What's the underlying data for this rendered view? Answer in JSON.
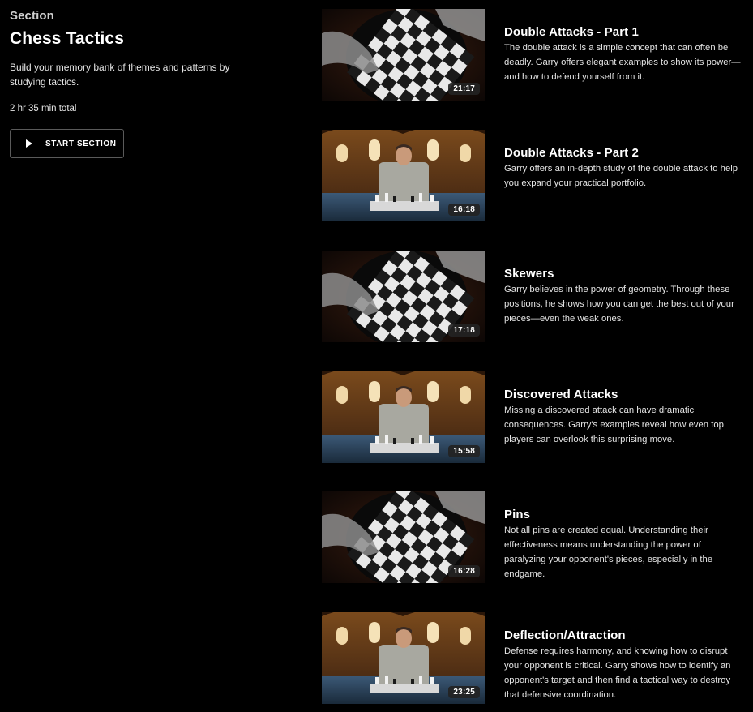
{
  "section": {
    "eyebrow": "Section",
    "title": "Chess Tactics",
    "description": "Build your memory bank of themes and patterns by studying tactics.",
    "total": "2 hr 35 min total",
    "start_label": "START SECTION"
  },
  "lessons": [
    {
      "title": "Double Attacks - Part 1",
      "description": "The double attack is a simple concept that can often be deadly. Garry offers elegant examples to show its power—and how to defend yourself from it.",
      "duration": "21:17",
      "thumbnail": "board-closeup"
    },
    {
      "title": "Double Attacks - Part 2",
      "description": "Garry offers an in-depth study of the double attack to help you expand your practical portfolio.",
      "duration": "16:18",
      "thumbnail": "instructor-hall"
    },
    {
      "title": "Skewers",
      "description": "Garry believes in the power of geometry. Through these positions, he shows how you can get the best out of your pieces—even the weak ones.",
      "duration": "17:18",
      "thumbnail": "board-closeup"
    },
    {
      "title": "Discovered Attacks",
      "description": "Missing a discovered attack can have dramatic consequences. Garry's examples reveal how even top players can overlook this surprising move.",
      "duration": "15:58",
      "thumbnail": "instructor-hall"
    },
    {
      "title": "Pins",
      "description": "Not all pins are created equal. Understanding their effectiveness means understanding the power of paralyzing your opponent's pieces, especially in the endgame.",
      "duration": "16:28",
      "thumbnail": "board-closeup"
    },
    {
      "title": "Deflection/Attraction",
      "description": "Defense requires harmony, and knowing how to disrupt your opponent is critical. Garry shows how to identify an opponent's target and then find a tactical way to destroy that defensive coordination.",
      "duration": "23:25",
      "thumbnail": "instructor-hall"
    }
  ],
  "colors": {
    "background": "#000000",
    "duration_badge": "#232323",
    "button_border": "#5a5a5a"
  }
}
